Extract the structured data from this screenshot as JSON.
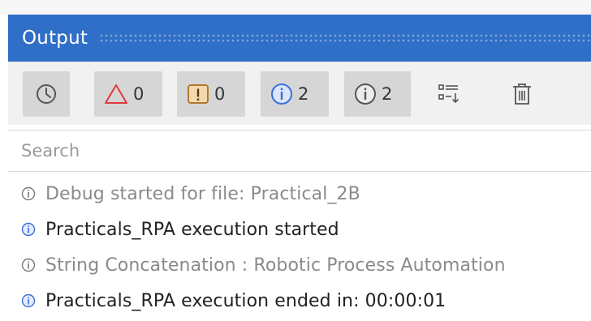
{
  "panel": {
    "title": "Output"
  },
  "toolbar": {
    "timestamp_button": {
      "icon": "clock-icon",
      "active": true
    },
    "errors": {
      "icon": "warning-triangle-icon",
      "count": "0",
      "color": "#e03a3a",
      "active": true
    },
    "warnings": {
      "icon": "exclamation-box-icon",
      "count": "0",
      "color": "#c0873a",
      "active": true
    },
    "info": {
      "icon": "info-circle-icon",
      "count": "2",
      "color": "#3a6fd8",
      "active": true
    },
    "trace": {
      "icon": "trace-info-icon",
      "count": "2",
      "color": "#555555",
      "active": true
    },
    "collapse_button": {
      "icon": "list-collapse-icon"
    },
    "clear_button": {
      "icon": "trash-icon"
    }
  },
  "search": {
    "placeholder": "Search",
    "value": ""
  },
  "log": [
    {
      "level": "trace",
      "text": "Debug started for file: Practical_2B"
    },
    {
      "level": "info",
      "text": "Practicals_RPA execution started"
    },
    {
      "level": "trace",
      "text": "String Concatenation : Robotic Process Automation"
    },
    {
      "level": "info",
      "text": "Practicals_RPA execution ended in: 00:00:01"
    }
  ],
  "colors": {
    "header_bg": "#2f6fc7",
    "info_blue": "#3a6fd8",
    "trace_gray": "#8a8a8a"
  }
}
